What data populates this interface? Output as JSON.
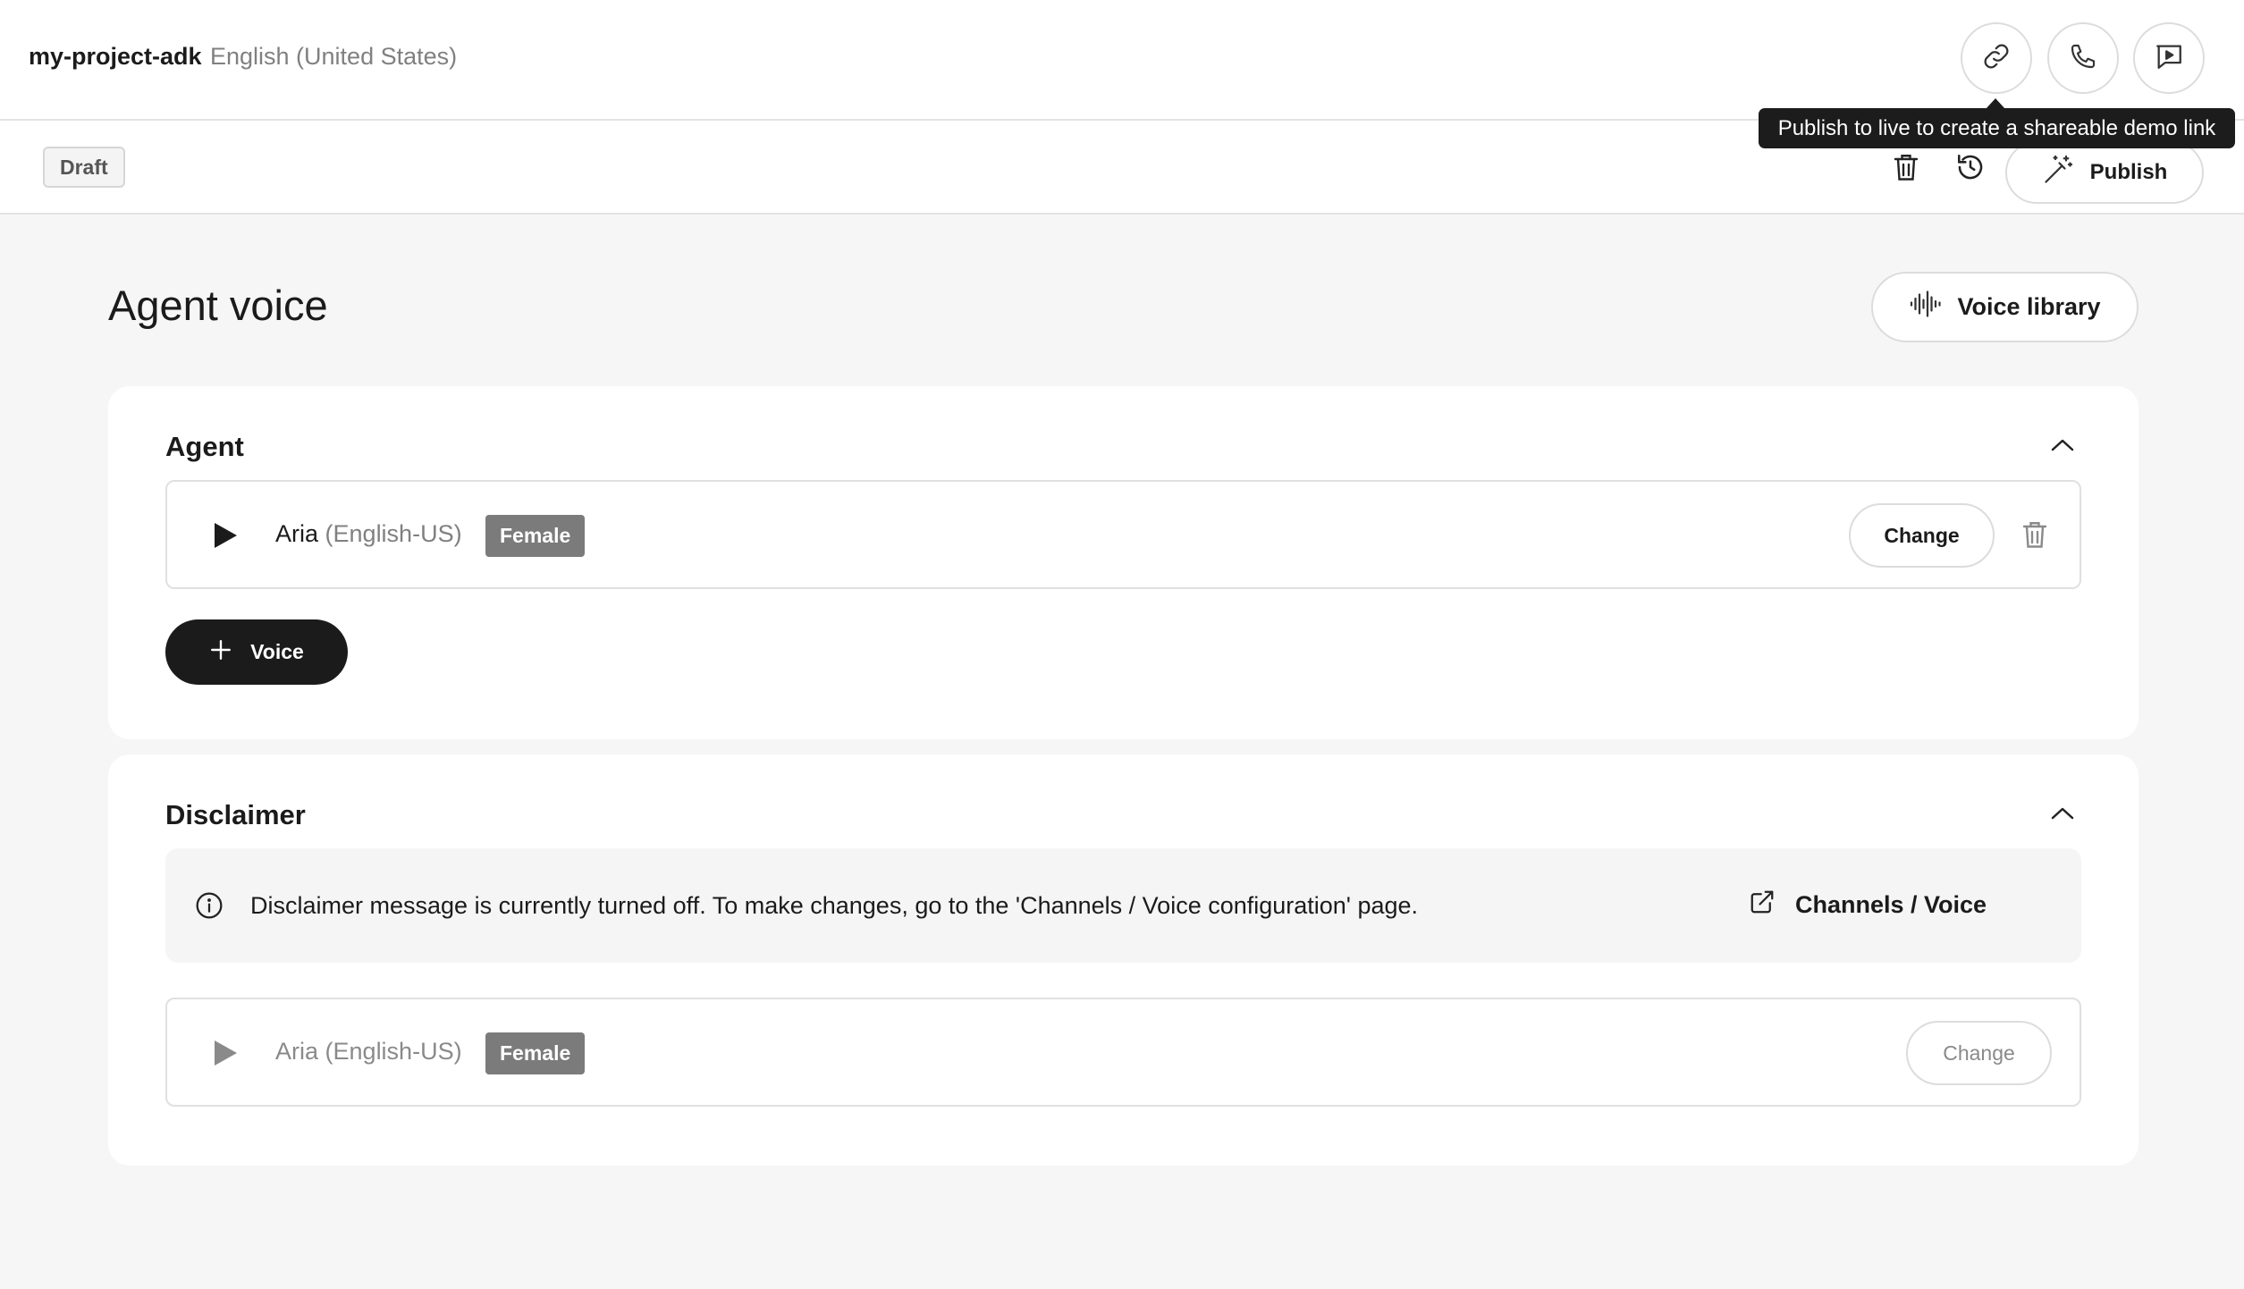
{
  "header": {
    "project_name": "my-project-adk",
    "language": "English (United States)",
    "tooltip": "Publish to live to create a shareable demo link"
  },
  "toolbar": {
    "status": "Draft",
    "publish_label": "Publish"
  },
  "page": {
    "title": "Agent voice",
    "voice_library_label": "Voice library"
  },
  "agent_section": {
    "title": "Agent",
    "voice": {
      "name": "Aria",
      "lang": "(English-US)",
      "gender": "Female"
    },
    "change_label": "Change",
    "add_voice_label": "Voice"
  },
  "disclaimer_section": {
    "title": "Disclaimer",
    "info_message": "Disclaimer message is currently turned off. To make changes, go to the 'Channels / Voice configuration' page.",
    "link_label": "Channels / Voice",
    "voice": {
      "name": "Aria",
      "lang": "(English-US)",
      "gender": "Female"
    },
    "change_label": "Change"
  },
  "colors": {
    "accent": "#1b1b1b",
    "badge": "#7b7b7b",
    "tooltip_bg": "#1c1c1c"
  }
}
